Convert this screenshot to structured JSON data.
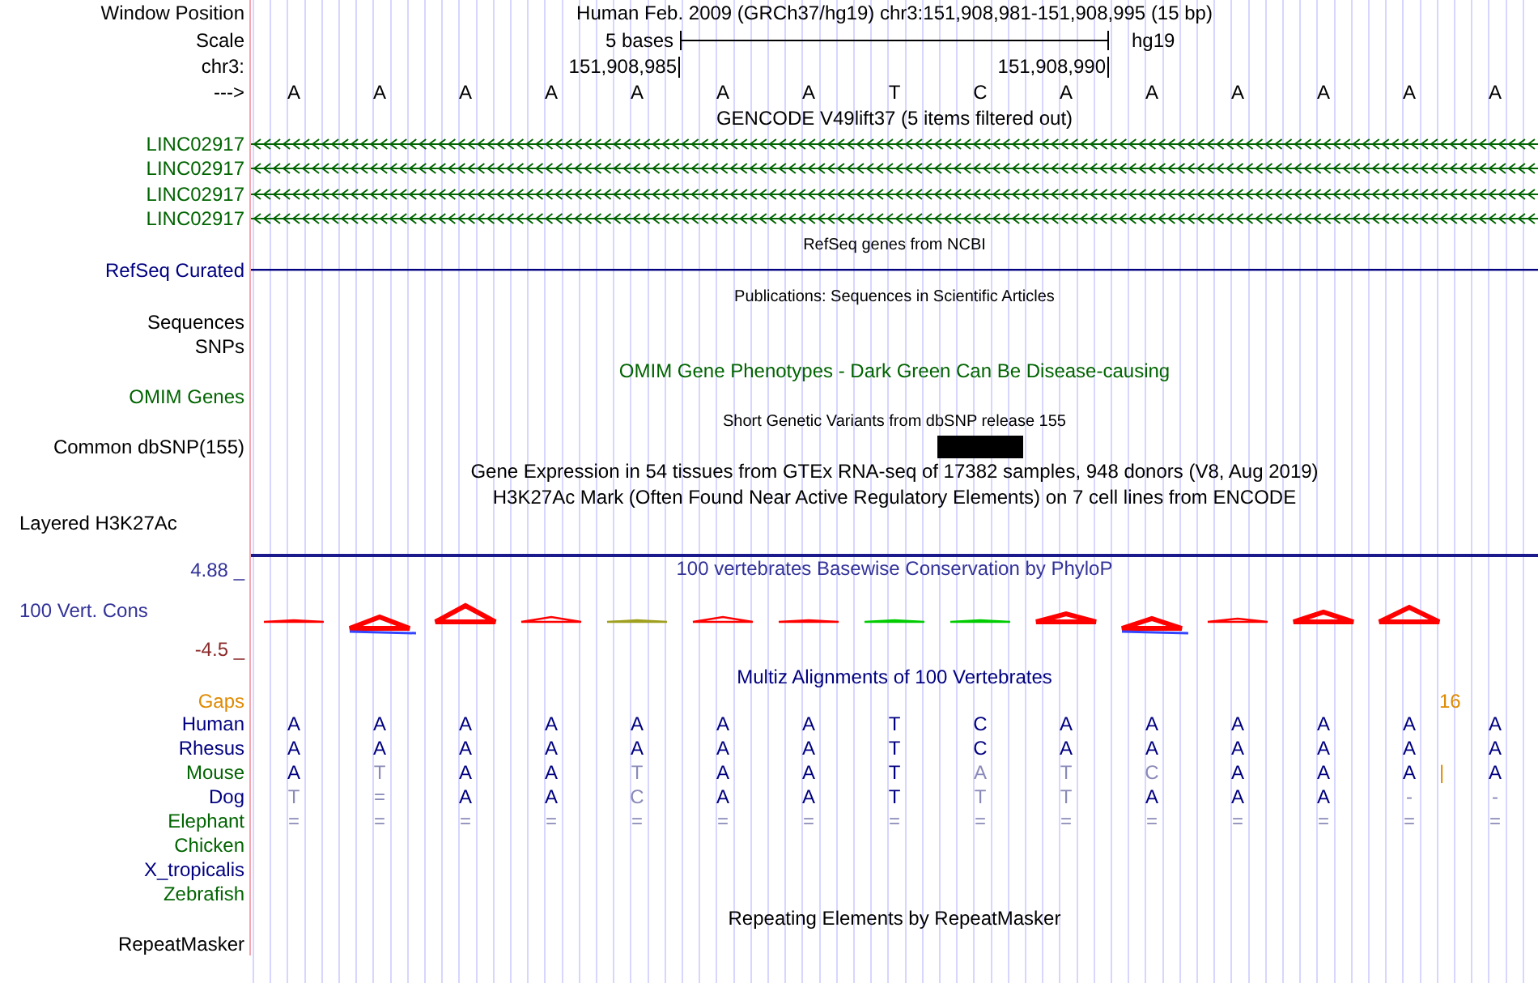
{
  "header": {
    "labels": [
      "Window Position",
      "Scale",
      "chr3:",
      "--->"
    ],
    "title": "Human Feb. 2009 (GRCh37/hg19)   chr3:151,908,981-151,908,995 (15 bp)",
    "scale": {
      "span": "5 bases",
      "assembly": "hg19"
    },
    "positions": [
      "151,908,985",
      "151,908,990"
    ],
    "bases": [
      "A",
      "A",
      "A",
      "A",
      "A",
      "A",
      "A",
      "T",
      "C",
      "A",
      "A",
      "A",
      "A",
      "A",
      "A"
    ]
  },
  "tracks": [
    {
      "kind": "gene",
      "title": "GENCODE V49lift37 (5 items filtered out)",
      "color": "#000000",
      "labels": [
        {
          "text": "LINC02917",
          "color": "#006400"
        },
        {
          "text": "LINC02917",
          "color": "#006400"
        },
        {
          "text": "LINC02917",
          "color": "#006400"
        },
        {
          "text": "LINC02917",
          "color": "#006400"
        }
      ]
    },
    {
      "kind": "line",
      "title": "RefSeq genes from NCBI",
      "color": "#000000",
      "labels": [
        {
          "text": "RefSeq Curated",
          "color": "#000080"
        }
      ]
    },
    {
      "kind": "empty",
      "title": "Publications: Sequences in Scientific Articles",
      "color": "#000000",
      "labels": [
        {
          "text": "Sequences",
          "color": "#000000"
        },
        {
          "text": "SNPs",
          "color": "#000000"
        }
      ]
    },
    {
      "kind": "text",
      "title": "OMIM Gene Phenotypes - Dark Green Can Be Disease-causing",
      "color": "#006400",
      "labels": [
        {
          "text": "OMIM Genes",
          "color": "#006400"
        }
      ]
    },
    {
      "kind": "snp",
      "title": "Short Genetic Variants from dbSNP release 155",
      "color": "#000000",
      "labels": [
        {
          "text": "Common dbSNP(155)",
          "color": "#000000"
        }
      ],
      "variants": [
        {
          "variant": false
        },
        {
          "variant": false
        },
        {
          "variant": false
        },
        {
          "variant": false
        },
        {
          "variant": false
        },
        {
          "variant": false
        },
        {
          "variant": false
        },
        {
          "variant": false
        },
        {
          "variant": true
        },
        {
          "variant": false
        },
        {
          "variant": false
        },
        {
          "variant": false
        },
        {
          "variant": false
        },
        {
          "variant": false
        },
        {
          "variant": false
        }
      ]
    },
    {
      "kind": "text",
      "title": "Gene Expression in 54 tissues from GTEx RNA-seq of 17382 samples, 948 donors (V8, Aug 2019)",
      "color": "#000000"
    },
    {
      "kind": "layered",
      "title": "H3K27Ac Mark (Often Found Near Active Regulatory Elements) on 7 cell lines from ENCODE",
      "color": "#000000",
      "labels": [
        {
          "text": "Layered H3K27Ac",
          "color": "#000000"
        }
      ]
    },
    {
      "kind": "conservation",
      "title": "100 vertebrates Basewise Conservation by PhyloP",
      "color": "#333399",
      "labels": [
        {
          "text": "4.88 _",
          "color": "#333399"
        },
        {
          "text": "100 Vert. Cons",
          "color": "#333399"
        },
        {
          "text": "-4.5 _",
          "color": "#8b2a2a"
        }
      ]
    },
    {
      "kind": "multiz",
      "title": "Multiz Alignments of 100 Vertebrates",
      "color": "#000080",
      "gaps": {
        "label": "Gaps",
        "value": "16",
        "color": "#e08a00"
      },
      "species": [
        {
          "name": "Human",
          "color": "#000080",
          "bases": [
            {
              "text": "A",
              "match": true
            },
            {
              "text": "A",
              "match": true
            },
            {
              "text": "A",
              "match": true
            },
            {
              "text": "A",
              "match": true
            },
            {
              "text": "A",
              "match": true
            },
            {
              "text": "A",
              "match": true
            },
            {
              "text": "A",
              "match": true
            },
            {
              "text": "T",
              "match": true
            },
            {
              "text": "C",
              "match": true
            },
            {
              "text": "A",
              "match": true
            },
            {
              "text": "A",
              "match": true
            },
            {
              "text": "A",
              "match": true
            },
            {
              "text": "A",
              "match": true
            },
            {
              "text": "A",
              "match": true
            },
            {
              "text": "A",
              "match": true
            }
          ]
        },
        {
          "name": "Rhesus",
          "color": "#000080",
          "bases": [
            {
              "text": "A",
              "match": true
            },
            {
              "text": "A",
              "match": true
            },
            {
              "text": "A",
              "match": true
            },
            {
              "text": "A",
              "match": true
            },
            {
              "text": "A",
              "match": true
            },
            {
              "text": "A",
              "match": true
            },
            {
              "text": "A",
              "match": true
            },
            {
              "text": "T",
              "match": true
            },
            {
              "text": "C",
              "match": true
            },
            {
              "text": "A",
              "match": true
            },
            {
              "text": "A",
              "match": true
            },
            {
              "text": "A",
              "match": true
            },
            {
              "text": "A",
              "match": true
            },
            {
              "text": "A",
              "match": true
            },
            {
              "text": "A",
              "match": true
            }
          ]
        },
        {
          "name": "Mouse",
          "color": "#006400",
          "insertion": "|",
          "bases": [
            {
              "text": "A",
              "match": true
            },
            {
              "text": "T",
              "match": false
            },
            {
              "text": "A",
              "match": true
            },
            {
              "text": "A",
              "match": true
            },
            {
              "text": "T",
              "match": false
            },
            {
              "text": "A",
              "match": true
            },
            {
              "text": "A",
              "match": true
            },
            {
              "text": "T",
              "match": true
            },
            {
              "text": "A",
              "match": false
            },
            {
              "text": "T",
              "match": false
            },
            {
              "text": "C",
              "match": false
            },
            {
              "text": "A",
              "match": true
            },
            {
              "text": "A",
              "match": true
            },
            {
              "text": "A",
              "match": true
            },
            {
              "text": "A",
              "match": true
            }
          ]
        },
        {
          "name": "Dog",
          "color": "#000080",
          "bases": [
            {
              "text": "T",
              "match": false
            },
            {
              "text": "=",
              "match": false
            },
            {
              "text": "A",
              "match": true
            },
            {
              "text": "A",
              "match": true
            },
            {
              "text": "C",
              "match": false
            },
            {
              "text": "A",
              "match": true
            },
            {
              "text": "A",
              "match": true
            },
            {
              "text": "T",
              "match": true
            },
            {
              "text": "T",
              "match": false
            },
            {
              "text": "T",
              "match": false
            },
            {
              "text": "A",
              "match": true
            },
            {
              "text": "A",
              "match": true
            },
            {
              "text": "A",
              "match": true
            },
            {
              "text": "-",
              "match": false
            },
            {
              "text": "-",
              "match": false
            }
          ]
        },
        {
          "name": "Elephant",
          "color": "#006400",
          "bases": [
            {
              "text": "=",
              "match": false
            },
            {
              "text": "=",
              "match": false
            },
            {
              "text": "=",
              "match": false
            },
            {
              "text": "=",
              "match": false
            },
            {
              "text": "=",
              "match": false
            },
            {
              "text": "=",
              "match": false
            },
            {
              "text": "=",
              "match": false
            },
            {
              "text": "=",
              "match": false
            },
            {
              "text": "=",
              "match": false
            },
            {
              "text": "=",
              "match": false
            },
            {
              "text": "=",
              "match": false
            },
            {
              "text": "=",
              "match": false
            },
            {
              "text": "=",
              "match": false
            },
            {
              "text": "=",
              "match": false
            },
            {
              "text": "=",
              "match": false
            }
          ]
        },
        {
          "name": "Chicken",
          "color": "#006400"
        },
        {
          "name": "X_tropicalis",
          "color": "#000080"
        },
        {
          "name": "Zebrafish",
          "color": "#006400"
        }
      ]
    },
    {
      "kind": "text",
      "title": "Repeating Elements by RepeatMasker",
      "color": "#000000",
      "labels": [
        {
          "text": "RepeatMasker",
          "color": "#000000"
        }
      ]
    }
  ]
}
